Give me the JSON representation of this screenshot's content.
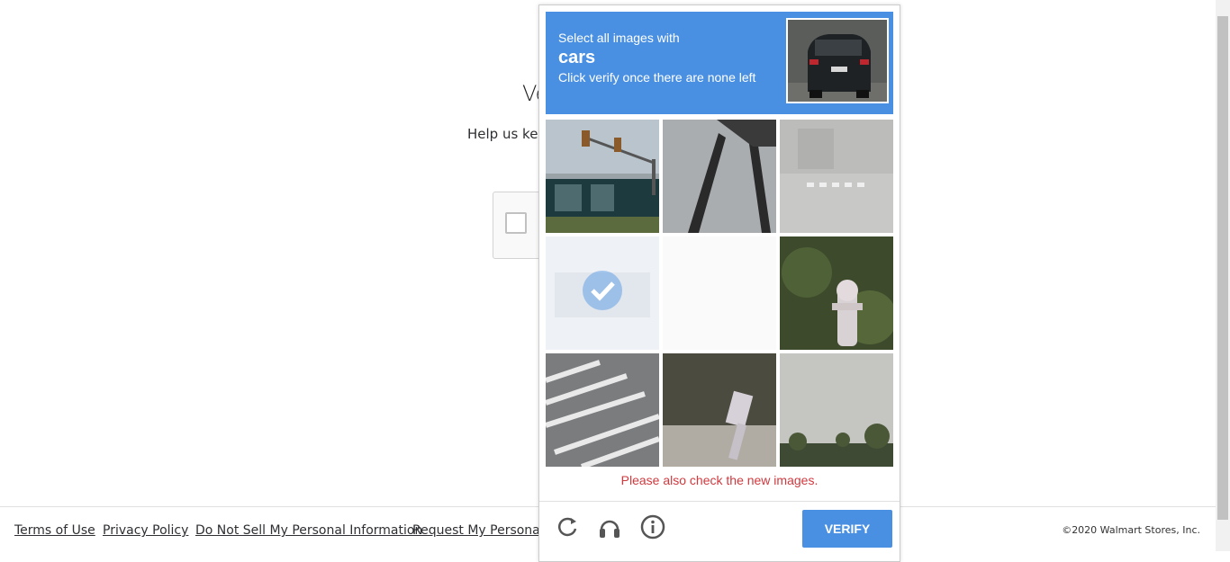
{
  "page": {
    "title": "Ve",
    "help_text": "Help us kee"
  },
  "footer": {
    "links": [
      "Terms of Use",
      "Privacy Policy",
      "Do Not Sell My Personal Information",
      "Request My Personal In"
    ],
    "copyright": "©2020 Walmart Stores, Inc."
  },
  "challenge": {
    "prompt": "Select all images with",
    "target": "cars",
    "instruction": "Click verify once there are none left",
    "error": "Please also check the new images.",
    "verify_label": "VERIFY",
    "tiles": [
      "traffic-light-building",
      "pole-shadow",
      "crosswalk-fog",
      "selected-car",
      "fading-blank",
      "fire-hydrant",
      "crosswalk-lines",
      "hydrant-slope",
      "palm-trees"
    ],
    "controls": [
      "reload-icon",
      "audio-icon",
      "info-icon"
    ]
  },
  "colors": {
    "accent": "#4a90e2",
    "error": "#d0393e"
  }
}
